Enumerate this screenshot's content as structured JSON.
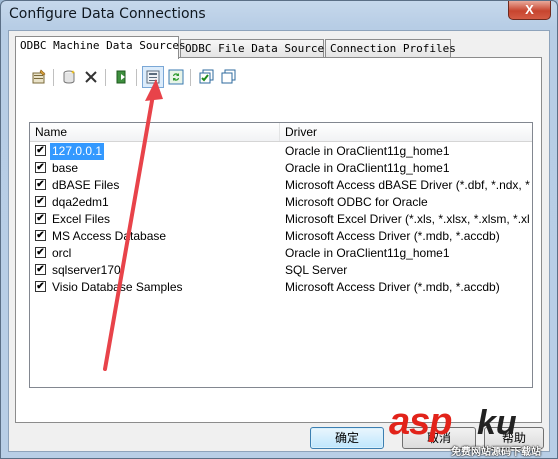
{
  "window": {
    "title": "Configure Data Connections",
    "close_glyph": "X"
  },
  "tabs": [
    {
      "label": "ODBC Machine Data Sources",
      "active": true
    },
    {
      "label": "ODBC File Data Sources",
      "active": false
    },
    {
      "label": "Connection Profiles",
      "active": false
    }
  ],
  "toolbar": {
    "icons": [
      "configure-icon",
      "new-datasource-icon",
      "delete-icon",
      "connect-icon",
      "datasource-properties-icon",
      "refresh-icon",
      "check-all-icon",
      "copy-icon"
    ]
  },
  "list": {
    "columns": [
      "Name",
      "Driver"
    ],
    "rows": [
      {
        "name": "127.0.0.1",
        "driver": "Oracle in OraClient11g_home1",
        "checked": true,
        "selected": true
      },
      {
        "name": "base",
        "driver": "Oracle in OraClient11g_home1",
        "checked": true,
        "selected": false
      },
      {
        "name": "dBASE Files",
        "driver": "Microsoft Access dBASE Driver (*.dbf, *.ndx, *.m...",
        "checked": true,
        "selected": false
      },
      {
        "name": "dqa2edm1",
        "driver": "Microsoft ODBC for Oracle",
        "checked": true,
        "selected": false
      },
      {
        "name": "Excel Files",
        "driver": "Microsoft Excel Driver (*.xls, *.xlsx, *.xlsm, *.xlsb)",
        "checked": true,
        "selected": false
      },
      {
        "name": "MS Access Database",
        "driver": "Microsoft Access Driver (*.mdb, *.accdb)",
        "checked": true,
        "selected": false
      },
      {
        "name": "orcl",
        "driver": "Oracle in OraClient11g_home1",
        "checked": true,
        "selected": false
      },
      {
        "name": "sqlserver170",
        "driver": "SQL Server",
        "checked": true,
        "selected": false
      },
      {
        "name": "Visio Database Samples",
        "driver": "Microsoft Access Driver (*.mdb, *.accdb)",
        "checked": true,
        "selected": false
      }
    ]
  },
  "buttons": {
    "ok_label": "确定",
    "second_label": "取消",
    "third_label": "帮助"
  },
  "watermark": {
    "asp": "asp",
    "ku": "ku",
    "sub": "免费网站源码下载站"
  },
  "colors": {
    "selection": "#3399ff",
    "annotation_arrow": "#e8434a"
  }
}
